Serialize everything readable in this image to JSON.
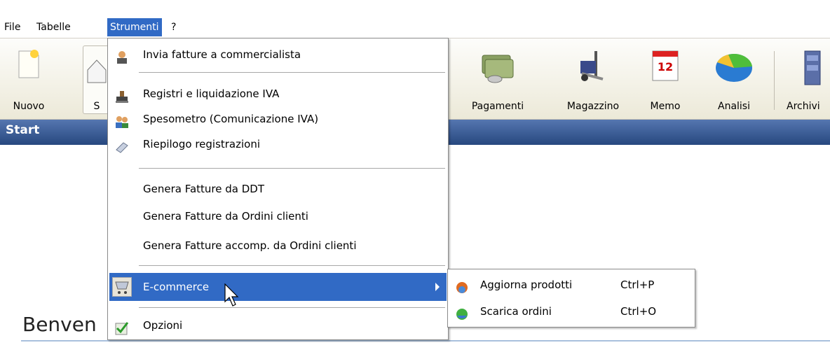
{
  "menubar": {
    "items": [
      {
        "label": "File",
        "active": false
      },
      {
        "label": "Tabelle",
        "active": false
      },
      {
        "label": "Strumenti",
        "active": true
      },
      {
        "label": "?",
        "active": false
      }
    ]
  },
  "toolbar": {
    "buttons": [
      {
        "label": "Nuovo",
        "icon": "new-document-icon"
      },
      {
        "label": "S",
        "icon": "home-icon"
      },
      {
        "label": "Pagamenti",
        "icon": "money-icon"
      },
      {
        "label": "Magazzino",
        "icon": "forklift-icon"
      },
      {
        "label": "Memo",
        "icon": "calendar-icon"
      },
      {
        "label": "Analisi",
        "icon": "pie-chart-icon"
      },
      {
        "label": "Archivi",
        "icon": "cabinet-icon"
      }
    ],
    "calendar_day": "12"
  },
  "startbar": {
    "title": "Start"
  },
  "content": {
    "welcome": "Benven"
  },
  "dropdown": {
    "items": [
      {
        "label": "Invia fatture a commercialista",
        "icon": "accountant-icon"
      },
      {
        "label": "Registri e liquidazione IVA",
        "icon": "stamp-icon"
      },
      {
        "label": "Spesometro (Comunicazione IVA)",
        "icon": "users-icon"
      },
      {
        "label": "Riepilogo registrazioni",
        "icon": "book-icon"
      },
      {
        "label": "Genera Fatture da DDT",
        "icon": ""
      },
      {
        "label": "Genera Fatture da Ordini clienti",
        "icon": ""
      },
      {
        "label": "Genera Fatture accomp. da Ordini clienti",
        "icon": ""
      },
      {
        "label": "E-commerce",
        "icon": "cart-icon"
      },
      {
        "label": "Opzioni",
        "icon": "checkmark-icon"
      }
    ]
  },
  "submenu": {
    "items": [
      {
        "label": "Aggiorna prodotti",
        "shortcut": "Ctrl+P",
        "icon": "update-icon"
      },
      {
        "label": "Scarica ordini",
        "shortcut": "Ctrl+O",
        "icon": "download-icon"
      }
    ]
  },
  "colors": {
    "highlight": "#316ac5",
    "startbar_top": "#5576b0",
    "startbar_bottom": "#27487f"
  }
}
